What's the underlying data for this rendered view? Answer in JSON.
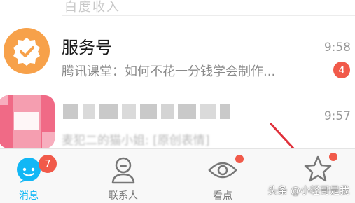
{
  "conversations": [
    {
      "title": "服务号",
      "subtitle": "腾讯课堂：如何不花一分钱学会制作...",
      "time": "9:58",
      "unread": "4",
      "avatar_icon": "service-account-badge-icon",
      "avatar_color": "#f7a14a"
    },
    {
      "title": "",
      "subtitle": "麦犯二的猫小姐: [原创表情]",
      "time": "9:57",
      "avatar_icon": "pixelated-avatar",
      "avatar_color": "#f06a86"
    }
  ],
  "top_row_faded_title": "白度收入",
  "tabbar": {
    "tabs": [
      {
        "label": "消息",
        "icon": "chat-bubble-icon",
        "badge": "7",
        "active": true
      },
      {
        "label": "联系人",
        "icon": "contacts-person-icon",
        "active": false
      },
      {
        "label": "看点",
        "icon": "eye-lens-icon",
        "dot": true,
        "active": false
      },
      {
        "label": "",
        "icon": "star-icon",
        "dot": true,
        "active": false
      }
    ]
  },
  "watermark": "头条 @小轻哥是我",
  "colors": {
    "accent": "#12b7f5",
    "badge": "#f15a4a",
    "annotation_arrow": "#e0303a"
  }
}
